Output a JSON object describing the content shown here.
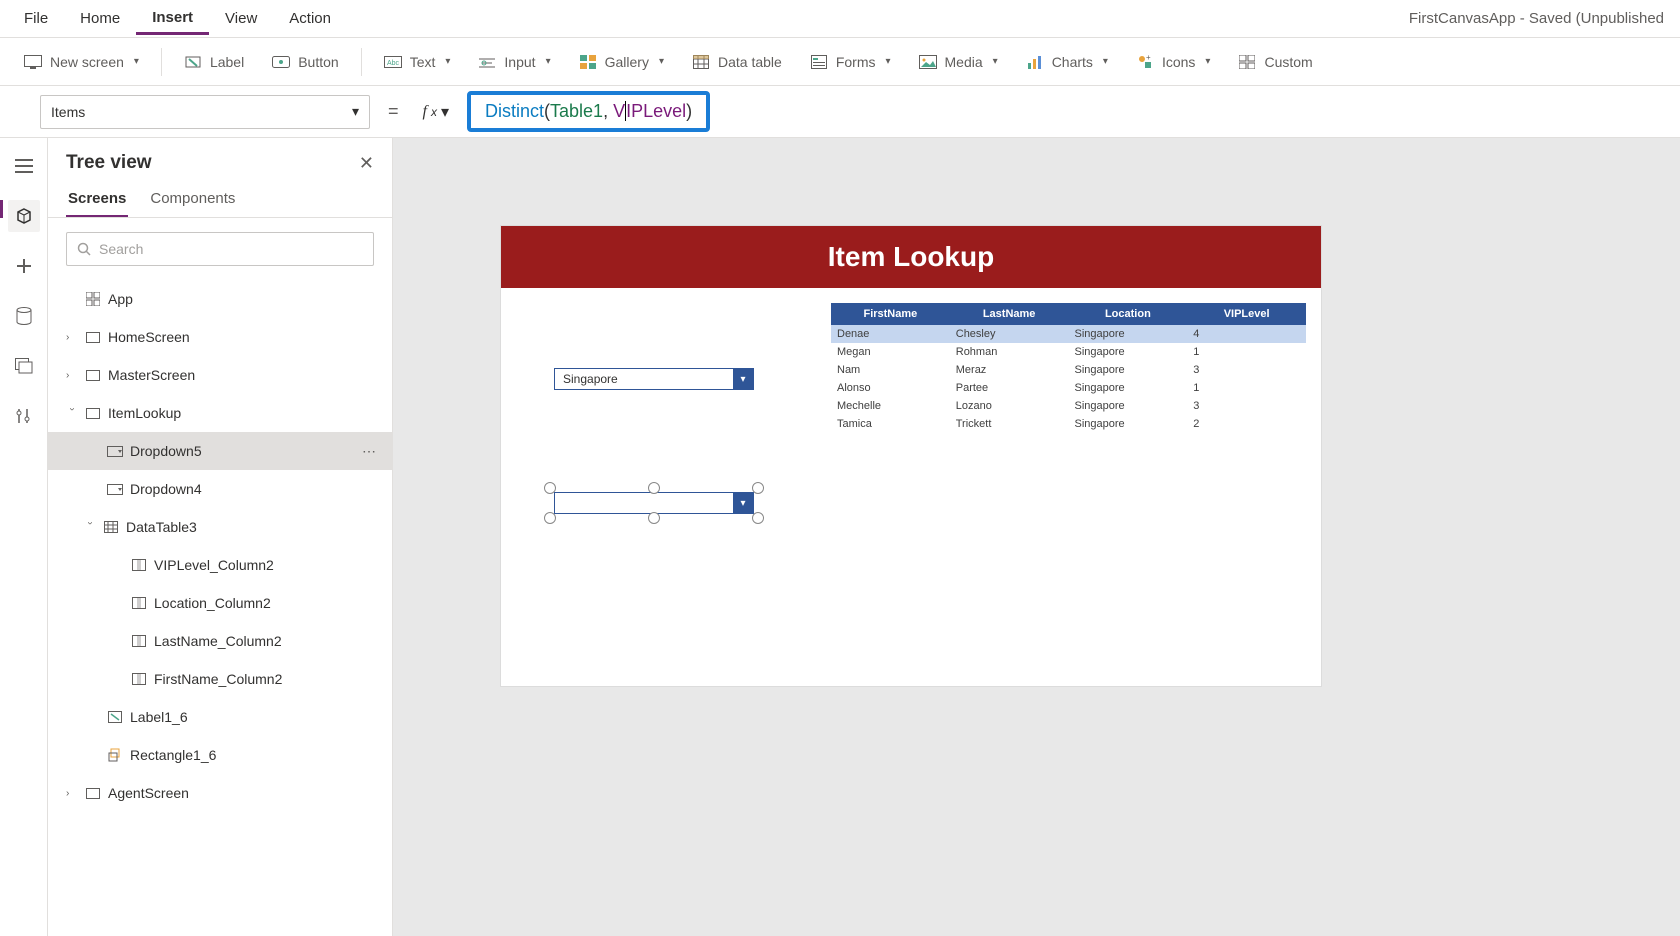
{
  "app_status": "FirstCanvasApp - Saved (Unpublished",
  "menubar": [
    "File",
    "Home",
    "Insert",
    "View",
    "Action"
  ],
  "menubar_active": 2,
  "ribbon": {
    "new_screen": "New screen",
    "label": "Label",
    "button": "Button",
    "text": "Text",
    "input": "Input",
    "gallery": "Gallery",
    "data_table": "Data table",
    "forms": "Forms",
    "media": "Media",
    "charts": "Charts",
    "icons": "Icons",
    "custom": "Custom"
  },
  "formula": {
    "property": "Items",
    "func": "Distinct",
    "table": "Table1",
    "column": "VIPLevel"
  },
  "tree": {
    "title": "Tree view",
    "tabs": [
      "Screens",
      "Components"
    ],
    "search_placeholder": "Search",
    "app": "App",
    "items": [
      "HomeScreen",
      "MasterScreen",
      "ItemLookup",
      "Dropdown5",
      "Dropdown4",
      "DataTable3",
      "VIPLevel_Column2",
      "Location_Column2",
      "LastName_Column2",
      "FirstName_Column2",
      "Label1_6",
      "Rectangle1_6",
      "AgentScreen"
    ]
  },
  "canvas": {
    "title": "Item Lookup",
    "dd1_value": "Singapore",
    "table_headers": [
      "FirstName",
      "LastName",
      "Location",
      "VIPLevel"
    ],
    "table_rows": [
      [
        "Denae",
        "Chesley",
        "Singapore",
        "4"
      ],
      [
        "Megan",
        "Rohman",
        "Singapore",
        "1"
      ],
      [
        "Nam",
        "Meraz",
        "Singapore",
        "3"
      ],
      [
        "Alonso",
        "Partee",
        "Singapore",
        "1"
      ],
      [
        "Mechelle",
        "Lozano",
        "Singapore",
        "3"
      ],
      [
        "Tamica",
        "Trickett",
        "Singapore",
        "2"
      ]
    ]
  }
}
